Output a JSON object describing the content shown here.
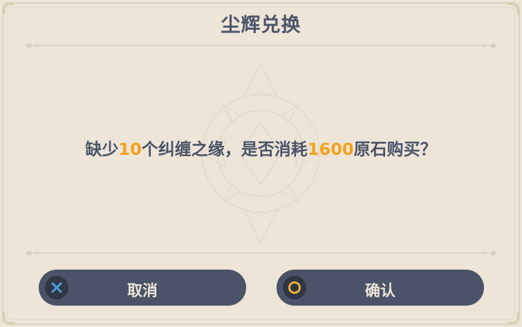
{
  "dialog": {
    "title": "尘辉兑换",
    "message": {
      "prefix": "缺少",
      "missing_count": "10",
      "middle": "个纠缠之缘，是否消耗",
      "cost": "1600",
      "suffix": "原石购买？"
    }
  },
  "buttons": {
    "cancel_label": "取消",
    "cancel_icon": "x-icon",
    "confirm_label": "确认",
    "confirm_icon": "circle-icon"
  },
  "colors": {
    "background": "#ece5d8",
    "text": "#4a5367",
    "highlight": "#f3a21b",
    "button_bg": "#4a5367",
    "button_text": "#ece5d8",
    "cancel_icon_color": "#4aa3e0",
    "confirm_icon_color": "#f3b13b"
  }
}
